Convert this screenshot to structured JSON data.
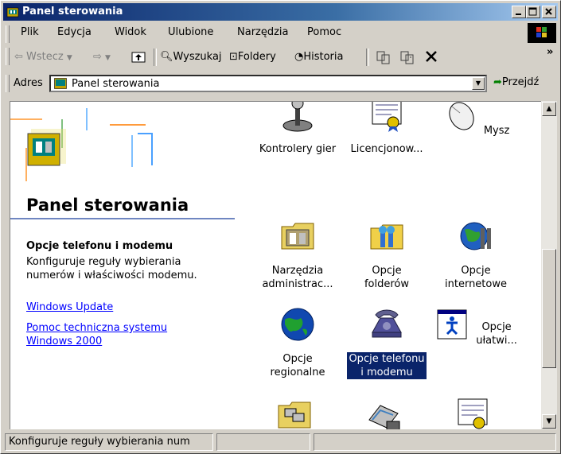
{
  "window": {
    "title": "Panel sterowania"
  },
  "menu": [
    {
      "label": "Plik"
    },
    {
      "label": "Edycja"
    },
    {
      "label": "Widok"
    },
    {
      "label": "Ulubione"
    },
    {
      "label": "Narzędzia"
    },
    {
      "label": "Pomoc"
    }
  ],
  "toolbar": {
    "back": "Wstecz",
    "search": "Wyszukaj",
    "folders": "Foldery",
    "history": "Historia",
    "overflow": "»"
  },
  "address": {
    "label": "Adres",
    "value": "Panel sterowania",
    "go": "Przejdź"
  },
  "left_panel": {
    "title": "Panel sterowania",
    "desc_title": "Opcje telefonu i modemu",
    "desc_body": "Konfiguruje reguły wybierania\nnumerów i właściwości modemu.",
    "links": [
      "Windows Update",
      "Pomoc techniczna systemu\nWindows 2000"
    ]
  },
  "items": [
    {
      "label": "Kontrolery gier",
      "icon": "joystick-icon"
    },
    {
      "label": "Licencjonow...",
      "icon": "certificate-icon"
    },
    {
      "label": "Mysz",
      "icon": "mouse-icon"
    },
    {
      "label": "Narzędzia\nadministrac...",
      "icon": "admin-tools-icon"
    },
    {
      "label": "Opcje\nfolderów",
      "icon": "folder-options-icon"
    },
    {
      "label": "Opcje\ninternetowe",
      "icon": "internet-options-icon"
    },
    {
      "label": "Opcje\nregionalne",
      "icon": "globe-icon"
    },
    {
      "label": "Opcje telefonu\ni modemu",
      "icon": "phone-icon",
      "selected": true
    },
    {
      "label": "Opcje\nułatwi...",
      "icon": "accessibility-icon"
    },
    {
      "label": "",
      "icon": "network-folder-icon"
    },
    {
      "label": "",
      "icon": "scanner-icon"
    },
    {
      "label": "",
      "icon": "certificate-icon"
    }
  ],
  "status": {
    "text": "Konfiguruje reguły wybierania num"
  },
  "colors": {
    "title_start": "#0a246a",
    "title_end": "#a6caf0",
    "selection": "#0a246a",
    "link": "#0000ff"
  }
}
